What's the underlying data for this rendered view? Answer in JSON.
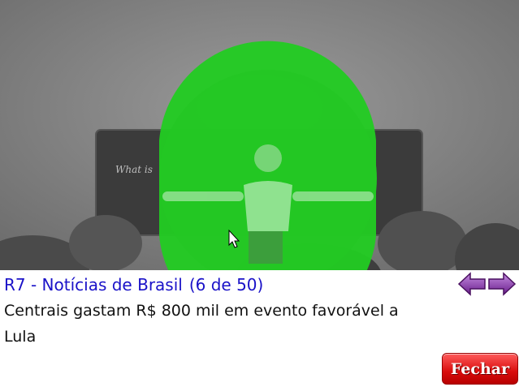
{
  "photo": {
    "board_text": "What is",
    "overlay_color": "#22cc22"
  },
  "news": {
    "source": "R7 - Notícias de Brasil",
    "count": "(6 de 50)",
    "headline": "Centrais gastam R$ 800 mil em evento favorável a Lula"
  },
  "nav": {
    "prev_icon": "arrow-left-icon",
    "next_icon": "arrow-right-icon",
    "arrow_color": "#7a2a9a"
  },
  "actions": {
    "close_label": "Fechar"
  }
}
